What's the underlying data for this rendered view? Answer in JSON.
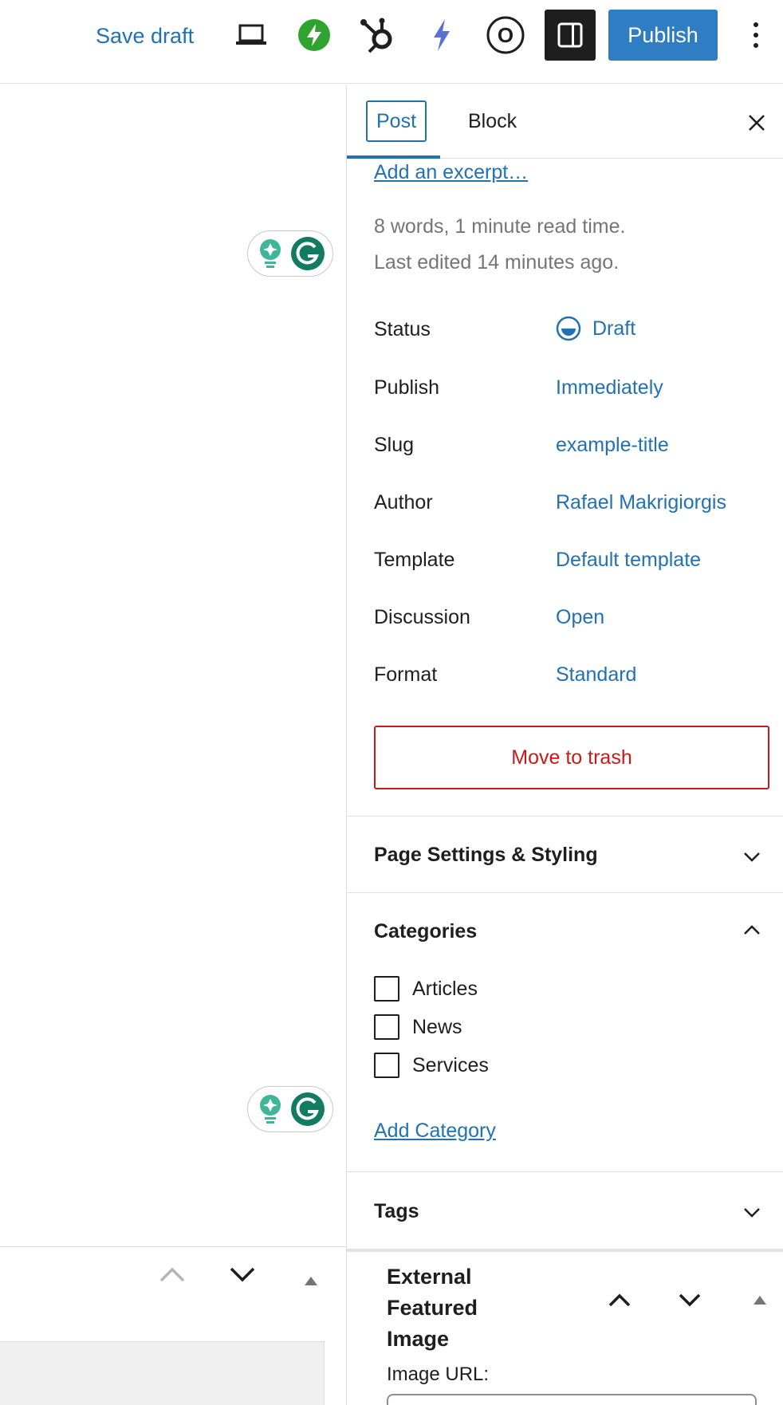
{
  "toolbar": {
    "save_draft_label": "Save draft",
    "publish_label": "Publish",
    "icons": [
      "laptop-preview-icon",
      "jetpack-icon",
      "hubspot-icon",
      "lightning-icon",
      "circle-o-icon",
      "sidebar-toggle-icon",
      "more-options-icon"
    ],
    "accent": "#2f7ec4",
    "jetpack_color": "#2fa32f",
    "lightning_color": "#5b6fd6"
  },
  "sidebar": {
    "tabs": [
      {
        "label": "Post"
      },
      {
        "label": "Block"
      }
    ],
    "excerpt_link": "Add an excerpt…",
    "word_count": "8 words, 1 minute read time.",
    "last_edited": "Last edited 14 minutes ago.",
    "rows": [
      {
        "label": "Status",
        "value": "Draft"
      },
      {
        "label": "Publish",
        "value": "Immediately"
      },
      {
        "label": "Slug",
        "value": "example-title"
      },
      {
        "label": "Author",
        "value": "Rafael Makrigiorgis"
      },
      {
        "label": "Template",
        "value": "Default template"
      },
      {
        "label": "Discussion",
        "value": "Open"
      },
      {
        "label": "Format",
        "value": "Standard"
      }
    ],
    "trash_label": "Move to trash",
    "panels": {
      "page_settings": "Page Settings & Styling",
      "categories": "Categories",
      "tags": "Tags"
    },
    "categories": [
      {
        "label": "Articles",
        "checked": false
      },
      {
        "label": "News",
        "checked": false
      },
      {
        "label": "Services",
        "checked": false
      }
    ],
    "add_category": "Add Category",
    "external_image": {
      "title": "External Featured Image",
      "image_url_label": "Image URL:"
    },
    "link_color": "#2271b1",
    "danger_color": "#cc1818"
  }
}
